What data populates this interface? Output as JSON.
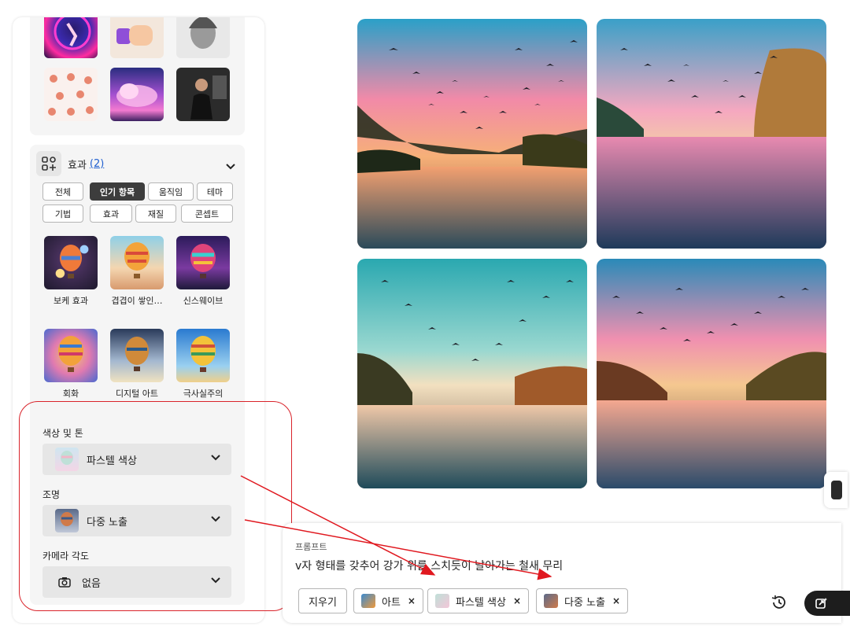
{
  "effects": {
    "title": "효과",
    "count": "(2)",
    "filter_chips": [
      "전체",
      "인기 항목",
      "움직임",
      "테마",
      "기법",
      "효과",
      "재질",
      "콘셉트"
    ],
    "active_chip": "인기 항목",
    "styles": [
      {
        "label": "보케 효과"
      },
      {
        "label": "겹겹이 쌓인…"
      },
      {
        "label": "신스웨이브"
      },
      {
        "label": "회화"
      },
      {
        "label": "디지털 아트"
      },
      {
        "label": "극사실주의"
      }
    ]
  },
  "color_tone": {
    "label": "색상 및 톤",
    "value": "파스텔 색상"
  },
  "lighting": {
    "label": "조명",
    "value": "다중 노출"
  },
  "camera_angle": {
    "label": "카메라 각도",
    "value": "없음"
  },
  "prompt": {
    "label": "프롬프트",
    "text": "v자 형태를 갖추어 강가 위를 스치듯이 날아가는 철새 무리",
    "clear_label": "지우기",
    "tags": [
      "아트",
      "파스텔 색상",
      "다중 노출"
    ]
  },
  "colors": {
    "accent_link": "#2160d0",
    "annotation_red": "#d9232a",
    "active_chip": "#3d3d3d"
  }
}
